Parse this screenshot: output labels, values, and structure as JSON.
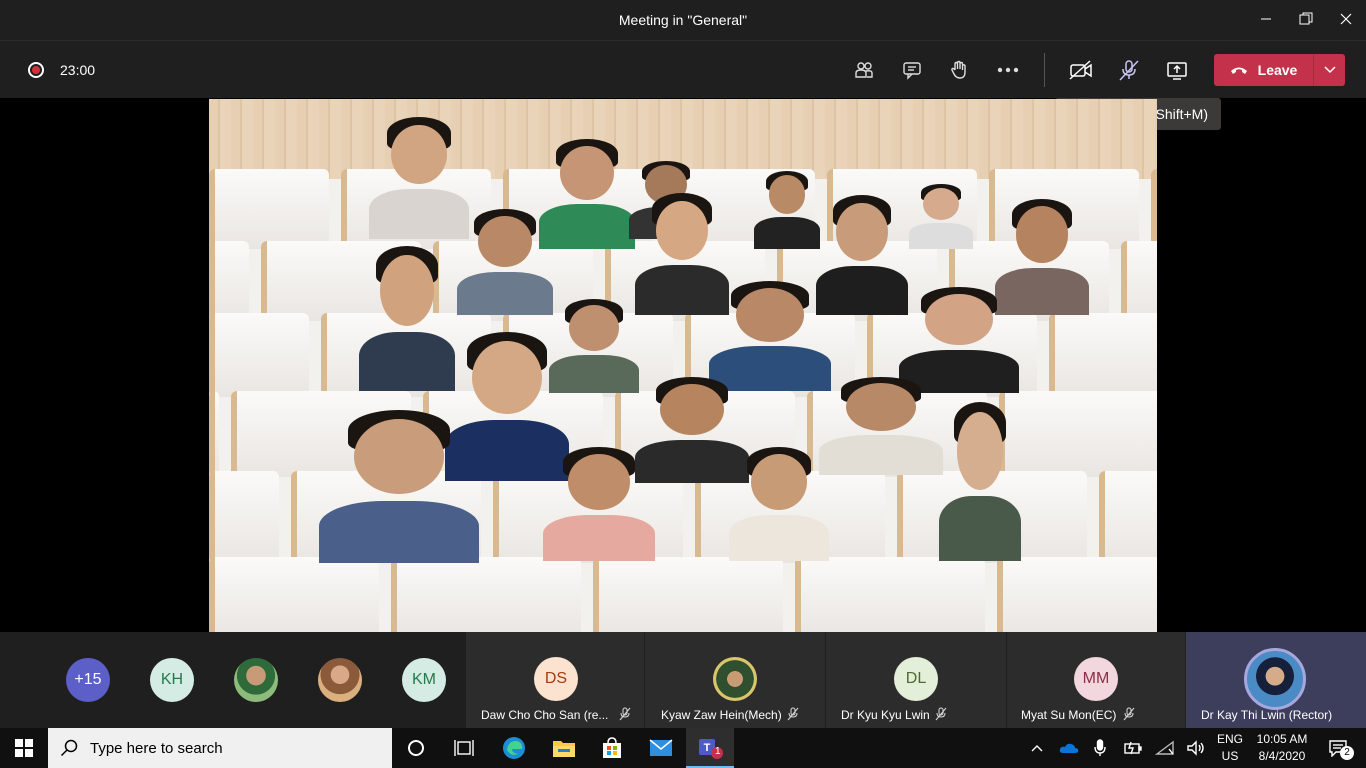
{
  "window": {
    "title": "Meeting in \"General\"",
    "minimize_icon": "minimize-icon",
    "maximize_icon": "restore-icon",
    "close_icon": "close-icon"
  },
  "toolbar": {
    "recording_icon": "record-icon",
    "elapsed": "23:00",
    "participants_icon": "people-icon",
    "chat_icon": "chat-icon",
    "raise_hand_icon": "hand-icon",
    "more_icon": "more-icon",
    "camera_icon": "camera-off-icon",
    "mic_icon": "mic-off-icon",
    "share_icon": "share-screen-icon",
    "leave_label": "Leave",
    "leave_color": "#c4314b"
  },
  "tooltip": {
    "text": "Unmute (Ctrl+Shift+M)"
  },
  "participants_overflow": {
    "more_count": "+15",
    "bubbles": [
      {
        "initials": "KH",
        "color": "#d4ece3",
        "text_color": "#237b4b"
      },
      {
        "initials": "",
        "photo": true
      },
      {
        "initials": "",
        "photo": true
      },
      {
        "initials": "KM",
        "color": "#d4ece3",
        "text_color": "#237b4b"
      }
    ]
  },
  "participant_tiles": [
    {
      "initials": "DS",
      "name": "Daw Cho Cho San (re...",
      "avatar_color": "#fbe3d0",
      "text_color": "#a33e0e",
      "muted": true
    },
    {
      "initials": "",
      "name": "Kyaw Zaw Hein(Mech)",
      "photo": true,
      "muted": true
    },
    {
      "initials": "DL",
      "name": "Dr Kyu Kyu Lwin",
      "avatar_color": "#e3efd9",
      "text_color": "#4d6b2f",
      "muted": true
    },
    {
      "initials": "MM",
      "name": "Myat Su Mon(EC)",
      "avatar_color": "#f3d7de",
      "text_color": "#8b2f46",
      "muted": true
    },
    {
      "initials": "",
      "name": "Dr Kay Thi Lwin (Rector)",
      "photo": true,
      "speaking": true
    }
  ],
  "taskbar": {
    "search_placeholder": "Type here to search",
    "apps": [
      "cortana-icon",
      "task-view-icon",
      "edge-icon",
      "file-explorer-icon",
      "store-icon",
      "mail-icon",
      "teams-icon"
    ],
    "teams_badge": "1",
    "language_top": "ENG",
    "language_bottom": "US",
    "time": "10:05 AM",
    "date": "8/4/2020",
    "notification_count": "2"
  }
}
